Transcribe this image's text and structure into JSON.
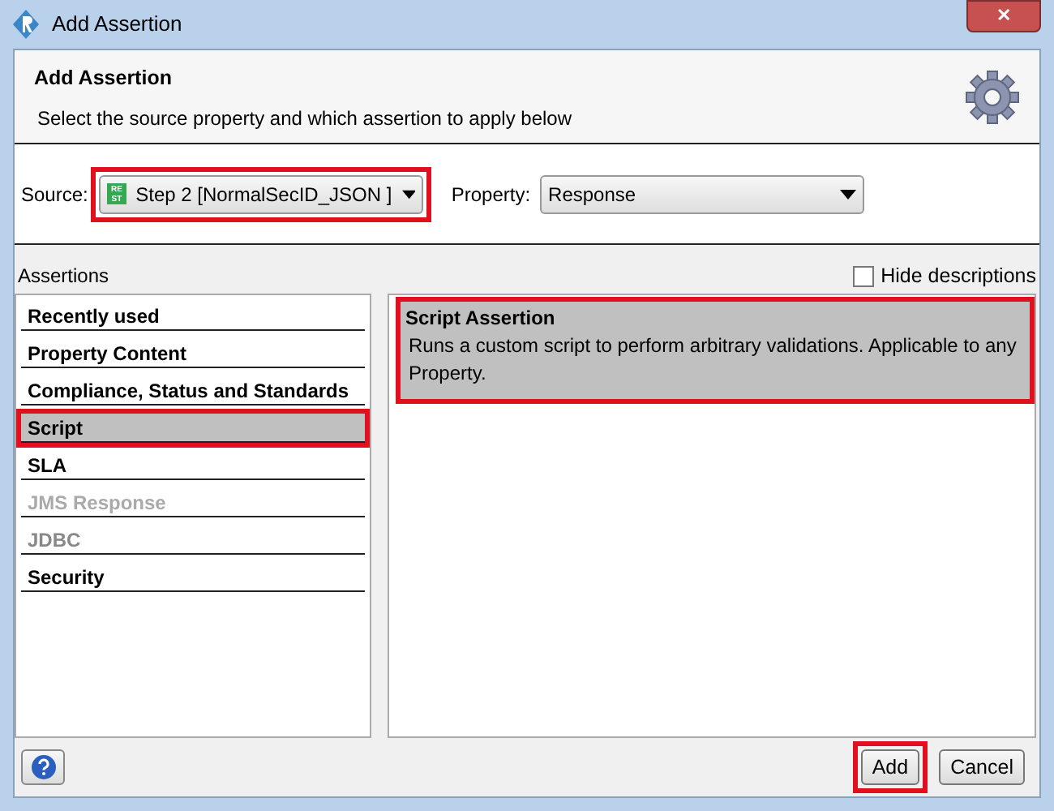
{
  "window": {
    "title": "Add Assertion",
    "close_glyph": "✕"
  },
  "header": {
    "title": "Add Assertion",
    "subtitle": "Select the source property and which assertion to apply below"
  },
  "source": {
    "label": "Source:",
    "value": "Step 2 [NormalSecID_JSON ]",
    "badge_top": "RE",
    "badge_bottom": "ST",
    "highlighted": true
  },
  "property": {
    "label": "Property:",
    "value": "Response"
  },
  "assertions_label": "Assertions",
  "hide_descriptions": {
    "label": "Hide descriptions",
    "checked": false
  },
  "categories": [
    {
      "label": "Recently used",
      "selected": false,
      "disabled": false,
      "highlighted": false
    },
    {
      "label": "Property Content",
      "selected": false,
      "disabled": false,
      "highlighted": false
    },
    {
      "label": "Compliance, Status and Standards",
      "selected": false,
      "disabled": false,
      "highlighted": false
    },
    {
      "label": "Script",
      "selected": true,
      "disabled": false,
      "highlighted": true
    },
    {
      "label": "SLA",
      "selected": false,
      "disabled": false,
      "highlighted": false
    },
    {
      "label": "JMS Response",
      "selected": false,
      "disabled": true,
      "highlighted": false
    },
    {
      "label": "JDBC",
      "selected": false,
      "disabled": true,
      "highlighted": false
    },
    {
      "label": "Security",
      "selected": false,
      "disabled": false,
      "highlighted": false
    }
  ],
  "assertion_items": [
    {
      "title": "Script Assertion",
      "description": "Runs a custom script to perform arbitrary validations. Applicable to any Property.",
      "selected": true,
      "highlighted": true
    }
  ],
  "buttons": [
    {
      "label": "Add",
      "highlighted": true
    },
    {
      "label": "Cancel",
      "highlighted": false
    }
  ]
}
